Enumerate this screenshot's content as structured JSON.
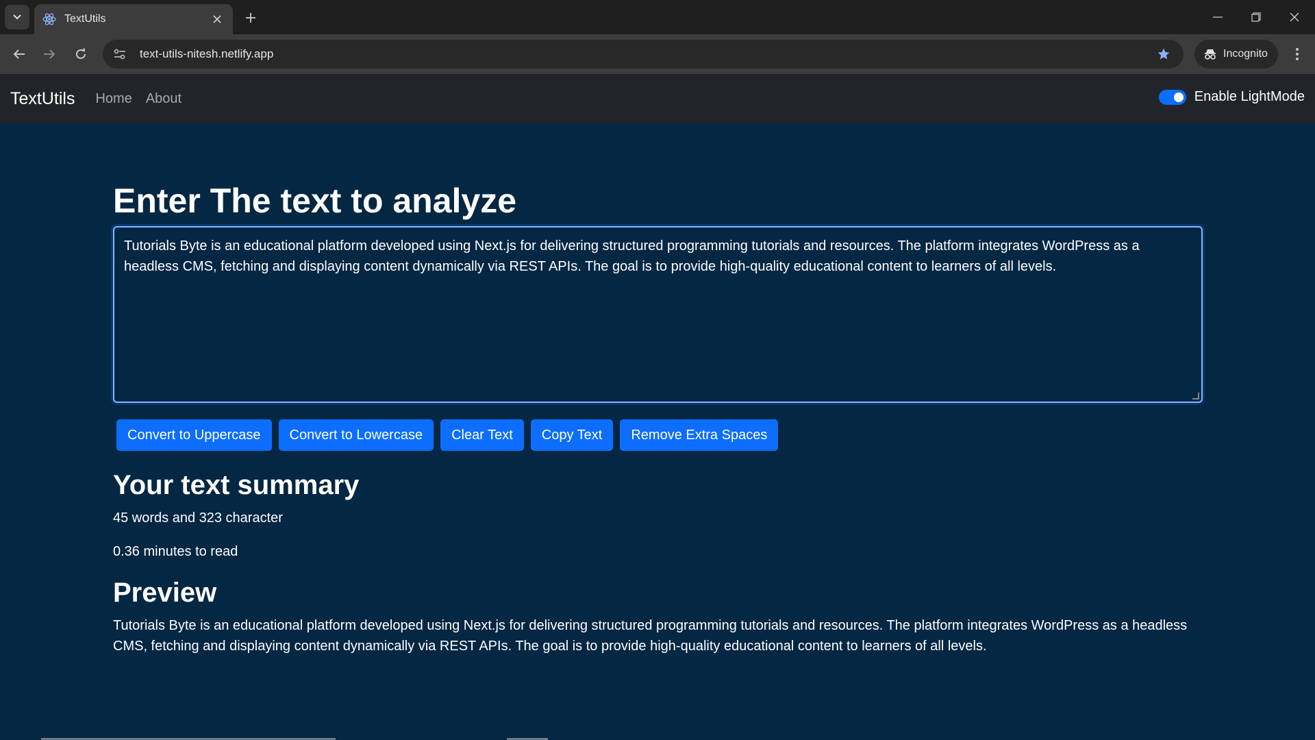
{
  "browser": {
    "tab_title": "TextUtils",
    "url": "text-utils-nitesh.netlify.app",
    "incognito_label": "Incognito"
  },
  "navbar": {
    "brand": "TextUtils",
    "links": [
      "Home",
      "About"
    ],
    "toggle_label": "Enable LightMode",
    "toggle_on": true
  },
  "main": {
    "heading": "Enter The text to analyze",
    "textarea_value": "Tutorials Byte is an educational platform developed using Next.js for delivering structured programming tutorials and resources. The platform integrates WordPress as a headless CMS, fetching and displaying content dynamically via REST APIs. The goal is to provide high-quality educational content to learners of all levels.",
    "buttons": [
      "Convert to Uppercase",
      "Convert to Lowercase",
      "Clear Text",
      "Copy Text",
      "Remove Extra Spaces"
    ],
    "summary_heading": "Your text summary",
    "word_count_text": "45 words and 323 character",
    "read_time_text": "0.36 minutes to read",
    "preview_heading": "Preview",
    "preview_text": "Tutorials Byte is an educational platform developed using Next.js for delivering structured programming tutorials and resources. The platform integrates WordPress as a headless CMS, fetching and displaying content dynamically via REST APIs. The goal is to provide high-quality educational content to learners of all levels."
  },
  "colors": {
    "page_bg": "#042743",
    "navbar_bg": "#212529",
    "accent": "#0d6efd"
  },
  "icons": [
    "tab-search-icon",
    "react-favicon-icon",
    "close-icon",
    "plus-icon",
    "minimize-icon",
    "restore-icon",
    "window-close-icon",
    "back-arrow-icon",
    "forward-arrow-icon",
    "reload-icon",
    "site-info-icon",
    "star-icon",
    "incognito-icon",
    "kebab-menu-icon"
  ]
}
